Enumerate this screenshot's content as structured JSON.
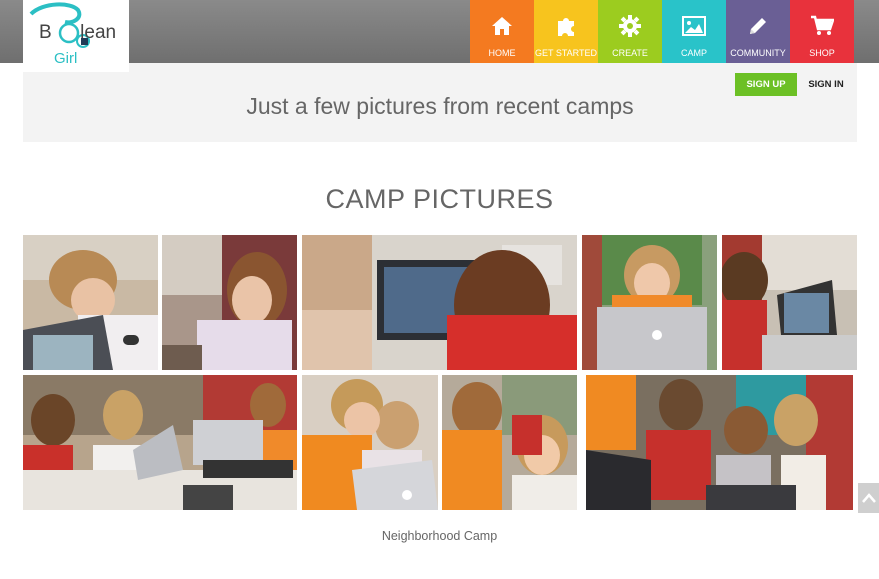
{
  "logo": {
    "text_main": "Boolean",
    "text_sub": "Girl"
  },
  "nav": {
    "items": [
      {
        "label": "HOME",
        "color": "#f47a20",
        "icon": "home-icon"
      },
      {
        "label": "GET STARTED",
        "color": "#f7c41e",
        "icon": "puzzle-icon"
      },
      {
        "label": "CREATE",
        "color": "#9ccc1f",
        "icon": "gear-icon"
      },
      {
        "label": "CAMP",
        "color": "#29c3c9",
        "icon": "image-icon"
      },
      {
        "label": "COMMUNITY",
        "color": "#6a5f95",
        "icon": "pencil-icon"
      },
      {
        "label": "SHOP",
        "color": "#e8323c",
        "icon": "cart-icon"
      }
    ]
  },
  "auth": {
    "signup_label": "SIGN UP",
    "signin_label": "SIGN IN"
  },
  "banner": {
    "headline": "Just a few pictures from recent camps"
  },
  "section": {
    "title": "CAMP PICTURES"
  },
  "gallery": {
    "caption": "Neighborhood Camp",
    "photos": [
      "girl-with-laptop-photo",
      "girl-thinking-photo",
      "girl-at-computer-photo",
      "girl-with-macbook-photo",
      "girl-typing-photo",
      "girls-at-table-photo",
      "two-girls-laptop-photo",
      "girls-smiling-photo",
      "girls-group-laptop-photo"
    ]
  },
  "scroll_top": {
    "icon": "chevron-up-icon"
  }
}
